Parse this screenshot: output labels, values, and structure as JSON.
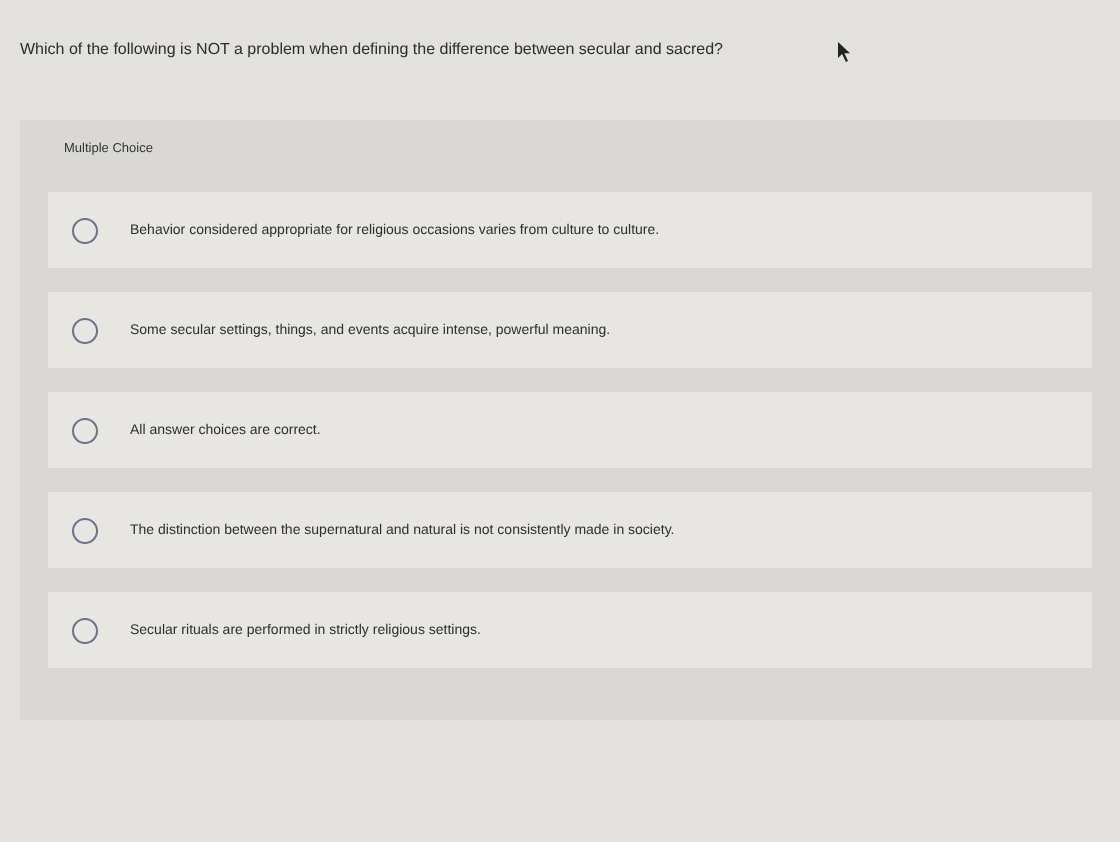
{
  "question": "Which of the following is NOT a problem when defining the difference between secular and sacred?",
  "question_type": "Multiple Choice",
  "choices": [
    {
      "text": "Behavior considered appropriate for religious occasions varies from culture to culture.",
      "selected": false
    },
    {
      "text": "Some secular settings, things, and events acquire intense, powerful meaning.",
      "selected": false
    },
    {
      "text": "All answer choices are correct.",
      "selected": false
    },
    {
      "text": "The distinction between the supernatural and natural is not consistently made in society.",
      "selected": false
    },
    {
      "text": "Secular rituals are performed in strictly religious settings.",
      "selected": false
    }
  ]
}
